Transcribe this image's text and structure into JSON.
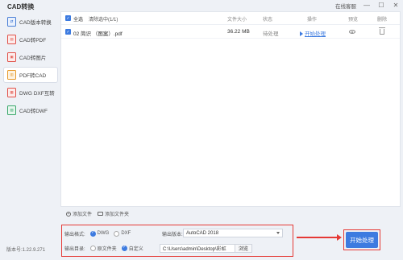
{
  "app": {
    "title": "CAD转换",
    "online_help": "在线客服",
    "version": "版本号:1.22.9.271"
  },
  "sidebar": {
    "items": [
      {
        "label": "CAD版本转换",
        "icon": "cad-version-icon",
        "color": "#4a7fd6",
        "active": false
      },
      {
        "label": "CAD转PDF",
        "icon": "pdf-icon",
        "color": "#e0524a",
        "active": false
      },
      {
        "label": "CAD转图片",
        "icon": "image-icon",
        "color": "#e0524a",
        "active": false
      },
      {
        "label": "PDF转CAD",
        "icon": "pdf-to-cad-icon",
        "color": "#e69b2e",
        "active": true
      },
      {
        "label": "DWG DXF互转",
        "icon": "dwg-dxf-icon",
        "color": "#e0524a",
        "active": false
      },
      {
        "label": "CAD转DWF",
        "icon": "dwf-icon",
        "color": "#3aa86b",
        "active": false
      }
    ]
  },
  "table": {
    "select_all": "全选",
    "clear_list": "清除选中(1/1)",
    "headers": {
      "size": "文件大小",
      "status": "状态",
      "action": "操作",
      "preview": "预览",
      "delete": "删除"
    },
    "rows": [
      {
        "name": "02 简识 （图案）.pdf",
        "size": "36.22 MB",
        "status": "待处理",
        "action": "开始处理"
      }
    ]
  },
  "add_bar": {
    "add_file": "添加文件",
    "add_folder": "添加文件夹"
  },
  "settings": {
    "format_label": "输出格式:",
    "formats": [
      {
        "label": "DWG",
        "selected": true
      },
      {
        "label": "DXF",
        "selected": false
      }
    ],
    "version_label": "输出版本:",
    "version_value": "AutoCAD 2018",
    "dir_label": "输出目录:",
    "dirs": [
      {
        "label": "原文件夹",
        "selected": false
      },
      {
        "label": "自定义",
        "selected": true
      }
    ],
    "path_value": "C:\\Users\\admin\\Desktop\\彩虹",
    "browse_label": "浏览"
  },
  "start_button": {
    "label": "开始处理"
  },
  "colors": {
    "accent": "#3d7be0",
    "highlight": "#e53935"
  }
}
